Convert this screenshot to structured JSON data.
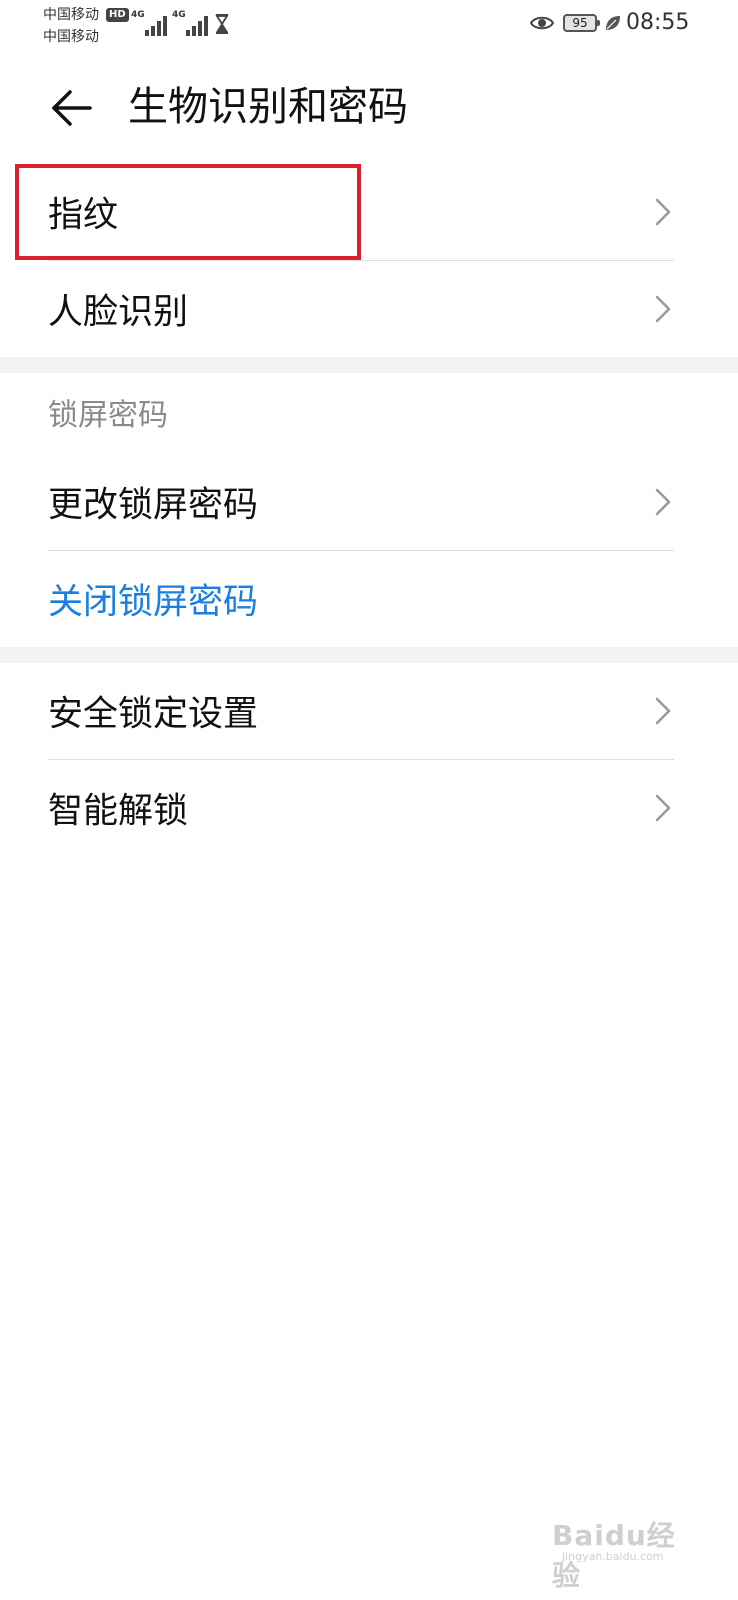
{
  "status_bar": {
    "carrier_1": "中国移动",
    "carrier_2": "中国移动",
    "hd_badge": "HD",
    "network_1": "4G",
    "network_2": "4G",
    "battery_level": "95",
    "time": "08:55",
    "icons": [
      "hd-icon",
      "signal-icon",
      "signal-icon",
      "hourglass-icon",
      "eye-icon",
      "battery-icon",
      "leaf-icon"
    ]
  },
  "header": {
    "title": "生物识别和密码",
    "back_icon": "back-arrow-icon"
  },
  "biometrics": {
    "items": [
      {
        "label": "指纹",
        "highlighted": true
      },
      {
        "label": "人脸识别"
      }
    ]
  },
  "lock_screen": {
    "section_title": "锁屏密码",
    "items": [
      {
        "label": "更改锁屏密码"
      },
      {
        "label": "关闭锁屏密码",
        "color": "#1a7fe0"
      }
    ]
  },
  "other": {
    "items": [
      {
        "label": "安全锁定设置"
      },
      {
        "label": "智能解锁"
      }
    ]
  },
  "watermark": {
    "main": "Baidu经验",
    "sub": "jingyan.baidu.com"
  },
  "colors": {
    "accent_blue": "#1a7fe0",
    "highlight_red": "#d9202c",
    "section_gap": "#f3f3f3"
  }
}
